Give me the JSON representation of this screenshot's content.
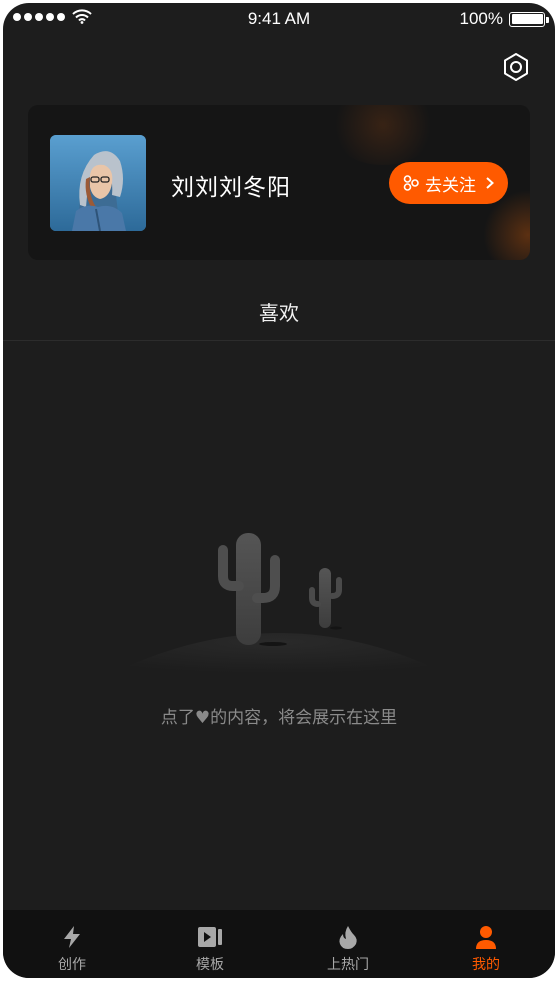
{
  "status_bar": {
    "time": "9:41 AM",
    "battery": "100%"
  },
  "profile": {
    "name": "刘刘刘冬阳",
    "follow_label": "去关注"
  },
  "section": {
    "title": "喜欢"
  },
  "empty_state": {
    "message": "点了♥的内容，将会展示在这里"
  },
  "tabbar": {
    "items": [
      {
        "label": "创作",
        "icon": "lightning-icon"
      },
      {
        "label": "模板",
        "icon": "video-template-icon"
      },
      {
        "label": "上热门",
        "icon": "flame-icon"
      },
      {
        "label": "我的",
        "icon": "person-icon"
      }
    ],
    "active_index": 3
  },
  "colors": {
    "accent": "#ff5a00",
    "background": "#1d1d1d",
    "card": "#151515",
    "tabbar": "#111111"
  }
}
